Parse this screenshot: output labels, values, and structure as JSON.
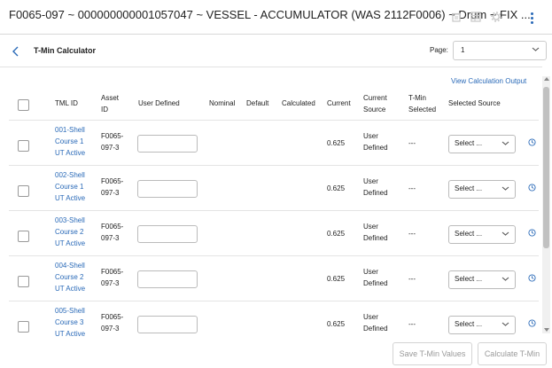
{
  "header": {
    "title": "F0065-097 ~ 000000000001057047 ~ VESSEL - ACCUMULATOR (WAS 2112F0006) ~ Drum ~ FIX ..."
  },
  "calculator": {
    "title": "T-Min Calculator",
    "page_label": "Page:",
    "page_value": "1",
    "view_output_link": "View Calculation Output"
  },
  "table": {
    "columns": {
      "tml_id": "TML ID",
      "asset_id_1": "Asset",
      "asset_id_2": "ID",
      "user_defined": "User Defined",
      "nominal": "Nominal",
      "default": "Default",
      "calculated": "Calculated",
      "current": "Current",
      "current_source_1": "Current",
      "current_source_2": "Source",
      "tmin_selected_1": "T-Min",
      "tmin_selected_2": "Selected",
      "selected_source": "Selected Source"
    },
    "rows": [
      {
        "tml_1": "001-Shell",
        "tml_2": "Course 1",
        "tml_3": "UT Active",
        "asset_1": "F0065-",
        "asset_2": "097-3",
        "current": "0.625",
        "source_1": "User",
        "source_2": "Defined",
        "tmin": "---",
        "select": "Select ..."
      },
      {
        "tml_1": "002-Shell",
        "tml_2": "Course 1",
        "tml_3": "UT Active",
        "asset_1": "F0065-",
        "asset_2": "097-3",
        "current": "0.625",
        "source_1": "User",
        "source_2": "Defined",
        "tmin": "---",
        "select": "Select ..."
      },
      {
        "tml_1": "003-Shell",
        "tml_2": "Course 2",
        "tml_3": "UT Active",
        "asset_1": "F0065-",
        "asset_2": "097-3",
        "current": "0.625",
        "source_1": "User",
        "source_2": "Defined",
        "tmin": "---",
        "select": "Select ..."
      },
      {
        "tml_1": "004-Shell",
        "tml_2": "Course 2",
        "tml_3": "UT Active",
        "asset_1": "F0065-",
        "asset_2": "097-3",
        "current": "0.625",
        "source_1": "User",
        "source_2": "Defined",
        "tmin": "---",
        "select": "Select ..."
      },
      {
        "tml_1": "005-Shell",
        "tml_2": "Course 3",
        "tml_3": "UT Active",
        "asset_1": "F0065-",
        "asset_2": "097-3",
        "current": "0.625",
        "source_1": "User",
        "source_2": "Defined",
        "tmin": "---",
        "select": "Select ..."
      }
    ]
  },
  "footer": {
    "save_label": "Save T-Min Values",
    "calculate_label": "Calculate T-Min"
  },
  "colors": {
    "accent": "#2a6ab8",
    "disabled_text": "#9a9a9a"
  }
}
